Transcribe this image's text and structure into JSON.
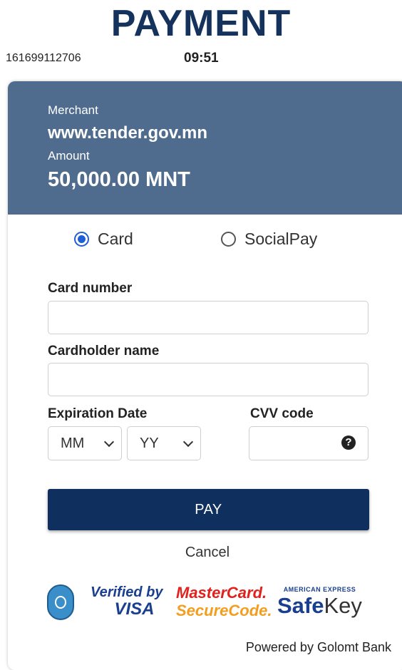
{
  "header": {
    "title": "PAYMENT",
    "transaction_id": "161699112706",
    "timer": "09:51"
  },
  "summary": {
    "merchant_label": "Merchant",
    "merchant_value": "www.tender.gov.mn",
    "amount_label": "Amount",
    "amount_value": "50,000.00 MNT",
    "panel_color": "#4f6c8e"
  },
  "payment_method": {
    "options": [
      {
        "label": "Card",
        "selected": true
      },
      {
        "label": "SocialPay",
        "selected": false
      }
    ]
  },
  "form": {
    "card_number_label": "Card number",
    "card_number_value": "",
    "cardholder_label": "Cardholder name",
    "cardholder_value": "",
    "expiration_label": "Expiration Date",
    "month_selected": "MM",
    "year_selected": "YY",
    "cvv_label": "CVV code",
    "cvv_value": "",
    "cvv_help_icon": "question-circle-icon"
  },
  "actions": {
    "pay_label": "PAY",
    "cancel_label": "Cancel",
    "pay_color": "#0f2f5f"
  },
  "logos": {
    "visa_line1": "Verified by",
    "visa_line2": "VISA",
    "mastercard_line1": "MasterCard.",
    "mastercard_line2": "SecureCode.",
    "amex_line1": "AMERICAN EXPRESS",
    "amex_line2_bold": "Safe",
    "amex_line2_rest": "Key"
  },
  "footer": {
    "powered_by": "Powered by Golomt Bank"
  }
}
